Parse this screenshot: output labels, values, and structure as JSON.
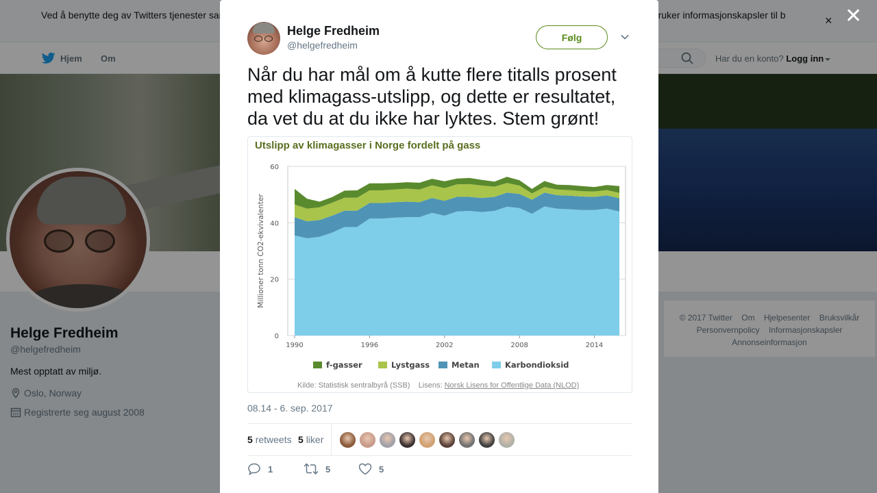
{
  "cookie_bar": {
    "text": "Ved å benytte deg av Twitters tjenester samtykker du i vår bruk av informasjonskapsler. Twitter og våre samarbeidspartnere opererer globalt, og bruker informasjonskapsler til b",
    "close": "×"
  },
  "nav": {
    "home": "Hjem",
    "about": "Om",
    "account_prompt": "Har du en konto?",
    "login": "Logg inn"
  },
  "profile": {
    "name": "Helge Fredheim",
    "handle": "@helgefredheim",
    "bio": "Mest opptatt av miljø.",
    "location": "Oslo, Norway",
    "joined": "Registrerte seg august 2008"
  },
  "footer": {
    "links": [
      "© 2017 Twitter",
      "Om",
      "Hjelpesenter",
      "Bruksvilkår",
      "Personvernpolicy",
      "Informasjonskapsler",
      "Annonseinformasjon"
    ]
  },
  "overlay": {
    "close": "✕"
  },
  "tweet": {
    "author_name": "Helge Fredheim",
    "author_handle": "@helgefredheim",
    "follow_label": "Følg",
    "text": "Når du har mål om å kutte flere titalls prosent med klimagass-utslipp, og dette er resultatet, da vet du at du ikke har lyktes. Stem grønt!",
    "date": "08.14 - 6. sep. 2017",
    "retweets_count": "5",
    "retweets_label": "retweets",
    "likes_count": "5",
    "likes_label": "liker",
    "reply_count": "1",
    "retweet_action_count": "5",
    "like_action_count": "5",
    "liker_colors": [
      "#8a5a3a",
      "#c89a8a",
      "#a0a0a8",
      "#3a3030",
      "#d0a070",
      "#5a4038",
      "#707070",
      "#404040",
      "#b0b0a8"
    ]
  },
  "chart_data": {
    "type": "area",
    "title": "Utslipp av klimagasser i Norge fordelt på gass",
    "ylabel": "Millioner tonn CO2-ekvivalenter",
    "xlabel": "",
    "ylim": [
      0,
      60
    ],
    "yticks": [
      "0",
      "20",
      "40",
      "60"
    ],
    "xticks": [
      "1990",
      "1996",
      "2002",
      "2008",
      "2014"
    ],
    "x": [
      1990,
      1991,
      1992,
      1993,
      1994,
      1995,
      1996,
      1997,
      1998,
      1999,
      2000,
      2001,
      2002,
      2003,
      2004,
      2005,
      2006,
      2007,
      2008,
      2009,
      2010,
      2011,
      2012,
      2013,
      2014,
      2015,
      2016
    ],
    "stacked": true,
    "series": [
      {
        "name": "Karbondioksid",
        "color": "#7ecde9",
        "values": [
          35.5,
          34.5,
          35.0,
          36.5,
          38.5,
          38.5,
          41.5,
          41.5,
          41.8,
          42.0,
          42.0,
          43.5,
          42.5,
          44.0,
          44.2,
          43.8,
          44.2,
          45.7,
          45.2,
          43.2,
          45.8,
          45.0,
          44.8,
          44.5,
          44.5,
          45.0,
          44.0
        ]
      },
      {
        "name": "Metan",
        "color": "#4f94b6",
        "values": [
          6.5,
          6.0,
          6.0,
          6.0,
          5.8,
          5.8,
          5.5,
          5.5,
          5.5,
          5.5,
          5.3,
          5.3,
          5.3,
          5.2,
          5.0,
          5.0,
          5.0,
          5.0,
          5.0,
          5.0,
          4.9,
          4.8,
          4.8,
          4.8,
          4.7,
          4.7,
          4.7
        ]
      },
      {
        "name": "Lystgass",
        "color": "#a9c44a",
        "values": [
          4.5,
          4.5,
          4.5,
          4.6,
          4.6,
          4.6,
          4.5,
          4.5,
          4.5,
          4.6,
          4.5,
          4.5,
          4.5,
          4.4,
          4.5,
          4.4,
          3.6,
          3.4,
          3.0,
          2.2,
          2.0,
          2.0,
          2.0,
          1.9,
          1.9,
          1.9,
          1.9
        ]
      },
      {
        "name": "f-gasser",
        "color": "#5a8a2e",
        "values": [
          5.5,
          3.5,
          2.0,
          2.0,
          2.5,
          2.6,
          2.5,
          2.5,
          2.3,
          2.3,
          2.4,
          2.3,
          2.4,
          2.1,
          2.2,
          2.0,
          1.8,
          2.2,
          1.9,
          1.6,
          2.1,
          1.7,
          1.8,
          1.8,
          1.6,
          1.8,
          2.4
        ]
      }
    ],
    "legend_position": "bottom",
    "source_label": "Kilde: Statistisk sentralbyrå (SSB)",
    "license_label": "Lisens:",
    "license_link": "Norsk Lisens for Offentlige Data (NLOD)"
  }
}
